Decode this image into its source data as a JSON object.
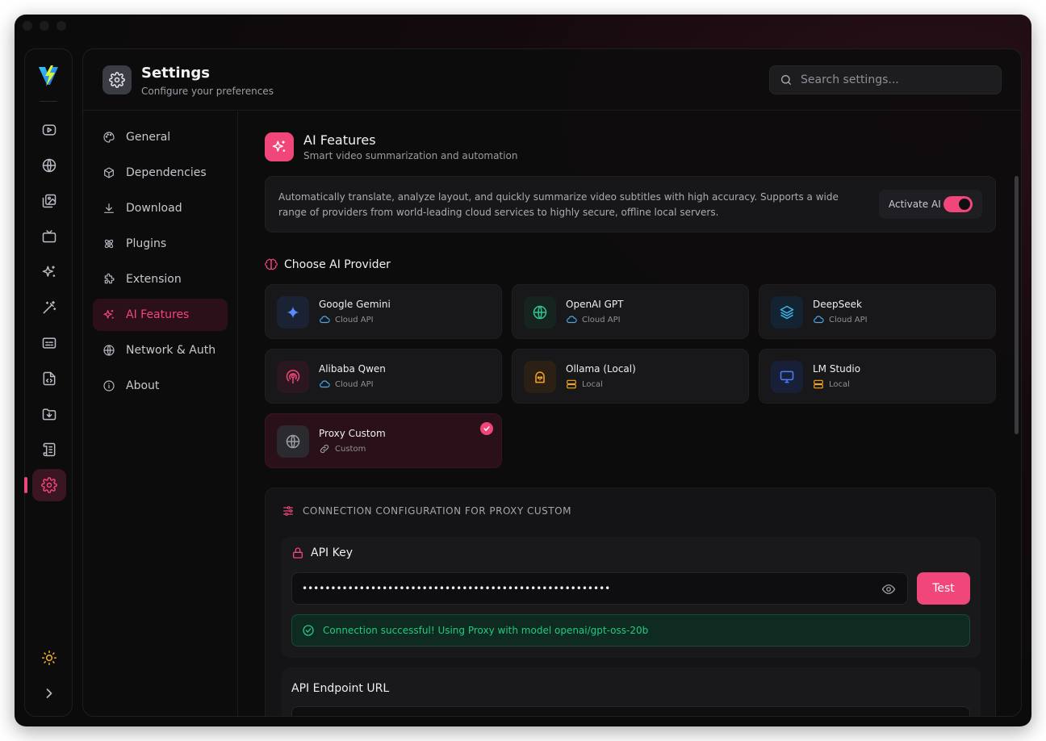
{
  "header": {
    "title": "Settings",
    "subtitle": "Configure your preferences",
    "search_placeholder": "Search settings..."
  },
  "rail": {
    "items": [
      "youtube-icon",
      "globe-icon",
      "images-icon",
      "tv-icon",
      "sparkles-icon",
      "magic-wand-icon",
      "captions-icon",
      "file-code-icon",
      "folder-download-icon",
      "scroll-icon",
      "gear-icon"
    ],
    "active": "gear-icon",
    "bottom": [
      "sun-icon",
      "chevron-right-icon"
    ]
  },
  "nav": {
    "items": [
      {
        "label": "General",
        "icon": "palette-icon"
      },
      {
        "label": "Dependencies",
        "icon": "box-icon"
      },
      {
        "label": "Download",
        "icon": "download-icon"
      },
      {
        "label": "Plugins",
        "icon": "atom-icon"
      },
      {
        "label": "Extension",
        "icon": "puzzle-icon"
      },
      {
        "label": "AI Features",
        "icon": "sparkles-icon"
      },
      {
        "label": "Network & Auth",
        "icon": "globe-icon"
      },
      {
        "label": "About",
        "icon": "info-icon"
      }
    ],
    "active": "AI Features"
  },
  "section": {
    "title": "AI Features",
    "subtitle": "Smart video summarization and automation",
    "description": "Automatically translate, analyze layout, and quickly summarize video subtitles with high accuracy. Supports a wide range of providers from world-leading cloud services to highly secure, offline local servers.",
    "activate_label": "Activate AI",
    "activate_on": true
  },
  "providers": {
    "heading": "Choose AI Provider",
    "items": [
      {
        "name": "Google Gemini",
        "type": "Cloud API"
      },
      {
        "name": "OpenAI GPT",
        "type": "Cloud API"
      },
      {
        "name": "DeepSeek",
        "type": "Cloud API"
      },
      {
        "name": "Alibaba Qwen",
        "type": "Cloud API"
      },
      {
        "name": "Ollama (Local)",
        "type": "Local"
      },
      {
        "name": "LM Studio",
        "type": "Local"
      },
      {
        "name": "Proxy Custom",
        "type": "Custom"
      }
    ],
    "selected": "Proxy Custom"
  },
  "config": {
    "title": "CONNECTION CONFIGURATION FOR PROXY CUSTOM",
    "api_key_label": "API Key",
    "api_key_value": "••••••••••••••••••••••••••••••••••••••••••••••••••••••",
    "test_label": "Test",
    "success_message": "Connection successful! Using Proxy with model openai/gpt-oss-20b",
    "endpoint_label": "API Endpoint URL"
  },
  "colors": {
    "accent": "#f0467a",
    "success": "#22c983",
    "background": "#0b0b0c"
  }
}
